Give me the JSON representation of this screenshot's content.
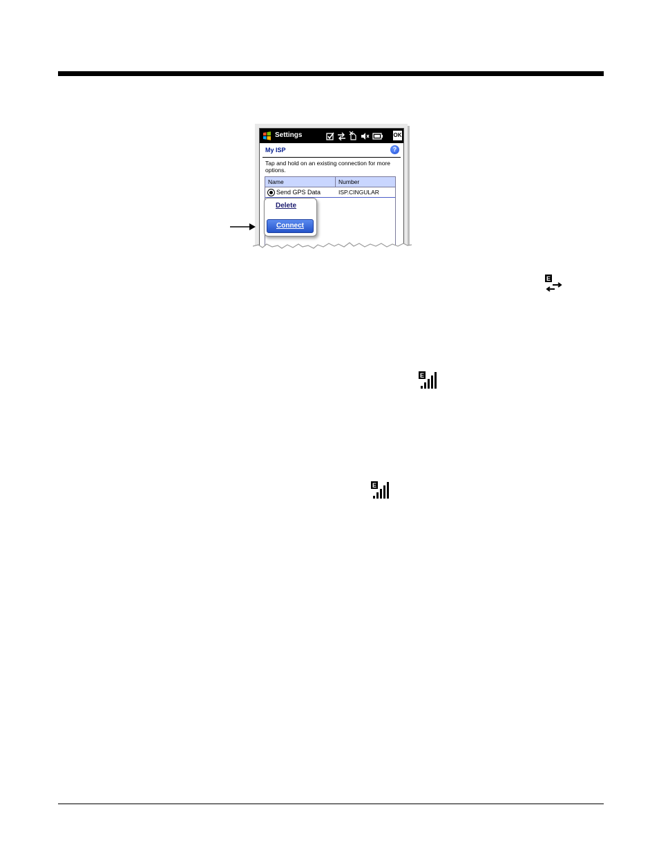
{
  "device": {
    "title": "Settings",
    "ok_label": "OK",
    "page_title": "My ISP",
    "help_label": "?",
    "instructions": "Tap and hold on an existing connection for more options.",
    "list": {
      "columns": [
        "Name",
        "Number"
      ],
      "rows": [
        {
          "name": "Send GPS Data",
          "number": "ISP.CINGULAR",
          "selected": true
        }
      ]
    },
    "context_menu": {
      "delete_label": "Delete",
      "connect_label": "Connect"
    }
  },
  "icons": {
    "edge_data_icon_label": "E",
    "edge_signal_icon_label": "E",
    "edge_signal_icon_label_2": "E"
  },
  "colors": {
    "titlebar": "#000000",
    "page_title": "#001a8c",
    "list_header": "#c9d6ff",
    "connect_button": "#2453c9"
  }
}
